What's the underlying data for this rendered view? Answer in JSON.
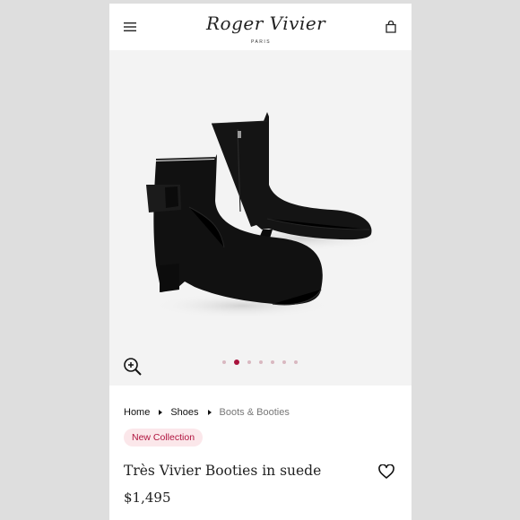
{
  "header": {
    "brand_name": "Roger Vivier",
    "brand_city": "PARIS",
    "menu_icon": "hamburger-menu-icon",
    "bag_icon": "shopping-bag-icon"
  },
  "gallery": {
    "zoom_icon": "zoom-in-icon",
    "slide_count": 7,
    "active_slide": 2
  },
  "breadcrumb": {
    "items": [
      "Home",
      "Shoes",
      "Boots & Booties"
    ]
  },
  "product": {
    "badge": "New Collection",
    "title": "Très Vivier Booties in suede",
    "price": "$1,495",
    "favorite_icon": "heart-icon"
  },
  "colors": {
    "accent": "#a8123c",
    "badge_bg": "#fbe7ea",
    "badge_text": "#b0143f",
    "page_bg": "#dedede",
    "gallery_bg": "#f3f3f3"
  }
}
